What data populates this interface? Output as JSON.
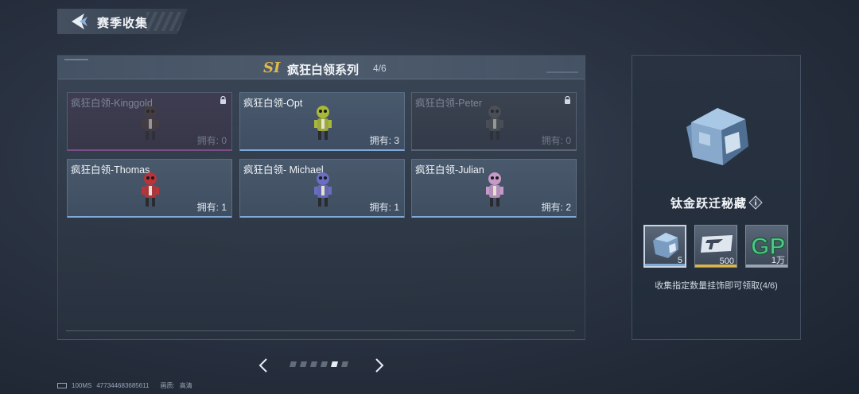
{
  "header": {
    "title": "赛季收集"
  },
  "series": {
    "badge": "SI",
    "title": "疯狂白领系列",
    "count": "4/6"
  },
  "cards": [
    {
      "name": "疯狂白领-Kinggold",
      "owned_label": "拥有: 0",
      "locked": true,
      "accent": "#7a4e86",
      "figure_color": "#4a4038"
    },
    {
      "name": "疯狂白领-Opt",
      "owned_label": "拥有: 3",
      "locked": false,
      "accent": "#7fa9d6",
      "figure_color": "#a8b83a"
    },
    {
      "name": "疯狂白领-Peter",
      "owned_label": "拥有: 0",
      "locked": true,
      "accent": "#5a6678",
      "figure_color": "#5a5c5e"
    },
    {
      "name": "疯狂白领-Thomas",
      "owned_label": "拥有: 1",
      "locked": false,
      "accent": "#7fa9d6",
      "figure_color": "#b8343a"
    },
    {
      "name": "疯狂白领- Michael",
      "owned_label": "拥有: 1",
      "locked": false,
      "accent": "#7fa9d6",
      "figure_color": "#6a6ec0"
    },
    {
      "name": "疯狂白领-Julian",
      "owned_label": "拥有: 2",
      "locked": false,
      "accent": "#7fa9d6",
      "figure_color": "#c69ac8"
    }
  ],
  "pagination": {
    "pages": 6,
    "active_index": 4
  },
  "reward": {
    "name": "钛金跃迁秘藏",
    "items": [
      {
        "qty": "5",
        "icon": "chest-icon",
        "rarity_color": "#7fa9d6"
      },
      {
        "qty": "500",
        "icon": "ticket-icon",
        "rarity_color": "#d9b64a"
      },
      {
        "qty": "1万",
        "icon": "gp-icon",
        "rarity_color": "#9aa6b4"
      }
    ],
    "hint": "收集指定数量挂饰即可领取(4/6)"
  },
  "footer": {
    "latency": "100MS",
    "uid": "477344683685611",
    "quality_label": "画质:",
    "quality_value": "高清"
  }
}
